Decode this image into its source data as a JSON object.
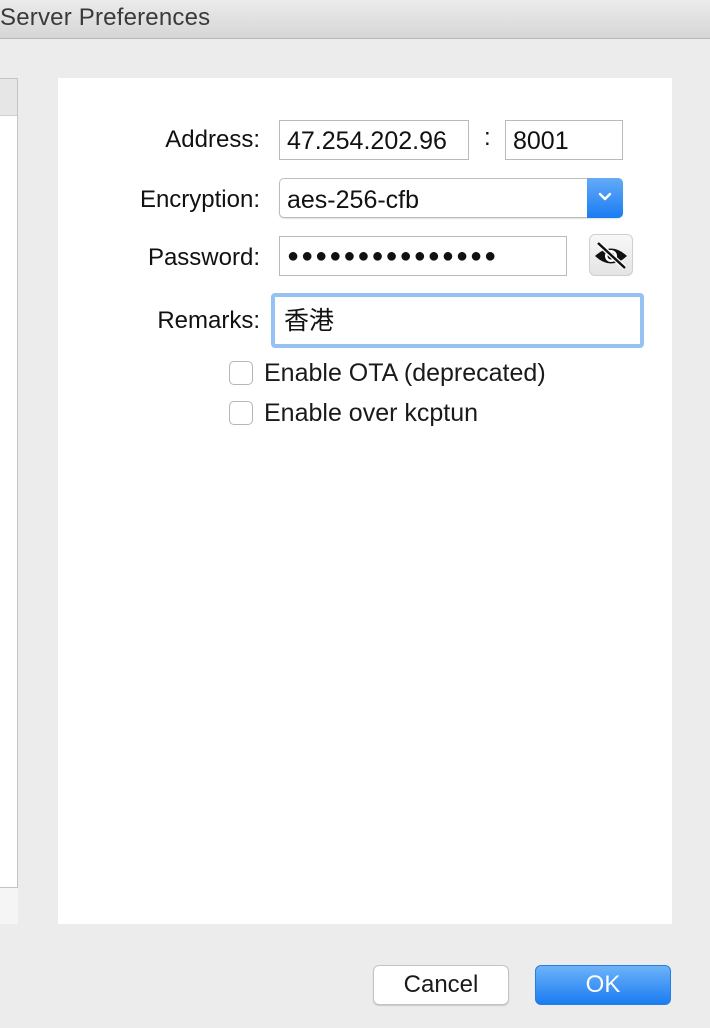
{
  "window": {
    "title": "Server Preferences"
  },
  "form": {
    "address_label": "Address:",
    "address_value": "47.254.202.96",
    "port_separator": ":",
    "port_value": "8001",
    "encryption_label": "Encryption:",
    "encryption_value": "aes-256-cfb",
    "password_label": "Password:",
    "password_masked": "●●●●●●●●●●●●●●●",
    "password_visibility_icon": "eye-slash-icon",
    "remarks_label": "Remarks:",
    "remarks_value": "香港",
    "ota_checkbox_label": "Enable OTA (deprecated)",
    "ota_checked": false,
    "kcptun_checkbox_label": "Enable over kcptun",
    "kcptun_checked": false
  },
  "buttons": {
    "cancel_label": "Cancel",
    "ok_label": "OK"
  },
  "colors": {
    "accent": "#1a7cf2",
    "focus_ring": "#95c2f3"
  }
}
